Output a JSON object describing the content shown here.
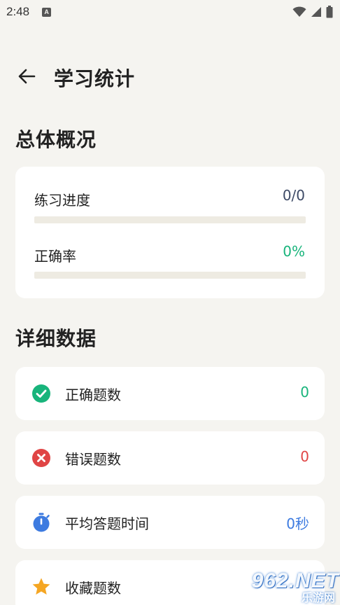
{
  "status_bar": {
    "time": "2:48",
    "notification_glyph": "A",
    "icons": [
      "wifi-icon",
      "signal-icon",
      "battery-icon"
    ]
  },
  "app_bar": {
    "title": "学习统计",
    "back_icon": "arrow-left-icon"
  },
  "overview": {
    "section_title": "总体概况",
    "rows": [
      {
        "label": "练习进度",
        "value": "0/0",
        "value_color": "#3d4a66",
        "progress": 0
      },
      {
        "label": "正确率",
        "value": "0%",
        "value_color": "#18b47b",
        "progress": 0
      }
    ]
  },
  "details": {
    "section_title": "详细数据",
    "items": [
      {
        "label": "正确题数",
        "value": "0",
        "value_color": "#18b47b",
        "icon": "check-circle-icon",
        "icon_color": "#18b47b"
      },
      {
        "label": "错误题数",
        "value": "0",
        "value_color": "#e04545",
        "icon": "x-circle-icon",
        "icon_color": "#e04545"
      },
      {
        "label": "平均答题时间",
        "value": "0秒",
        "value_color": "#3d7be0",
        "icon": "stopwatch-icon",
        "icon_color": "#3d7be0"
      },
      {
        "label": "收藏题数",
        "value": "",
        "value_color": "#f0a020",
        "icon": "star-icon",
        "icon_color": "#f5a623"
      }
    ]
  },
  "watermark": {
    "brand": "962.NET",
    "sub": "乐游网"
  },
  "colors": {
    "background": "#f5f4f0",
    "card": "#ffffff",
    "track": "#eeebe2"
  }
}
